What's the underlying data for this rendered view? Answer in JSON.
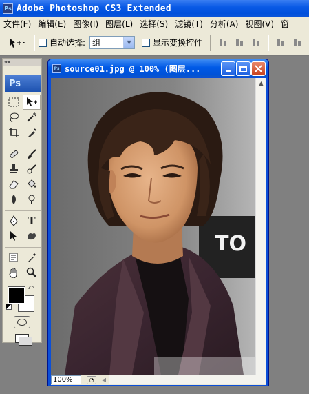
{
  "app": {
    "icon_label": "Ps",
    "title": "Adobe Photoshop CS3 Extended"
  },
  "menu": {
    "items": [
      "文件(F)",
      "编辑(E)",
      "图像(I)",
      "图层(L)",
      "选择(S)",
      "滤镜(T)",
      "分析(A)",
      "视图(V)",
      "窗"
    ]
  },
  "options": {
    "auto_select_label": "自动选择:",
    "auto_select_value": "组",
    "show_transform_label": "显示变换控件"
  },
  "toolbox": {
    "collapse_label": "◂◂",
    "logo": "Ps"
  },
  "document": {
    "icon_label": "Ps",
    "title": "source01.jpg @ 100% (图层...",
    "zoom": "100%"
  },
  "colors": {
    "title_bar": "#0054e3",
    "foreground": "#000000",
    "background": "#ffffff",
    "close_button": "#c7401c"
  }
}
